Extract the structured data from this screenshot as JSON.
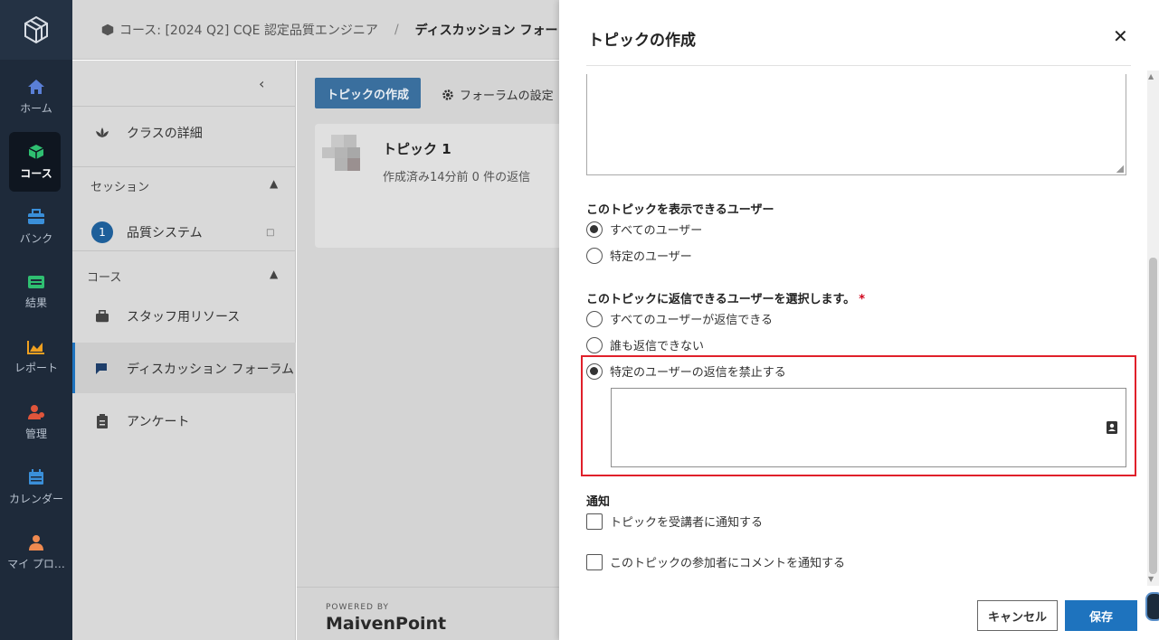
{
  "rail": {
    "items": [
      {
        "label": "ホーム",
        "icon": "home-icon",
        "color": "#5a7fd6"
      },
      {
        "label": "コース",
        "icon": "cube-icon",
        "color": "#2fbf71",
        "active": true
      },
      {
        "label": "バンク",
        "icon": "briefcase-icon",
        "color": "#3a8fd9"
      },
      {
        "label": "結果",
        "icon": "list-icon",
        "color": "#2fbf71"
      },
      {
        "label": "レポート",
        "icon": "chart-icon",
        "color": "#f0a020"
      },
      {
        "label": "管理",
        "icon": "users-gear-icon",
        "color": "#e0553b"
      },
      {
        "label": "カレンダー",
        "icon": "calendar-icon",
        "color": "#3a8fd9"
      },
      {
        "label": "マイ プロ…",
        "icon": "person-icon",
        "color": "#f08a50"
      }
    ]
  },
  "breadcrumb": {
    "course": "コース: [2024 Q2] CQE 認定品質エンジニア",
    "current": "ディスカッション フォーラム"
  },
  "leftnav": {
    "class_details": "クラスの詳細",
    "session_header": "セッション",
    "session_item_number": "1",
    "session_item": "品質システム",
    "course_header": "コース",
    "staff_resources": "スタッフ用リソース",
    "discussion_forum": "ディスカッション フォーラム",
    "survey": "アンケート"
  },
  "main": {
    "create_topic": "トピックの作成",
    "forum_settings": "フォーラムの設定",
    "topic": {
      "title": "トピック 1",
      "meta": "作成済み14分前  0 件の返信"
    },
    "powered_by": "POWERED BY",
    "brand": "MaivenPoint"
  },
  "drawer": {
    "title": "トピックの作成",
    "visibility_label": "このトピックを表示できるユーザー",
    "visibility_options": [
      "すべてのユーザー",
      "特定のユーザー"
    ],
    "visibility_selected": 0,
    "reply_label": "このトピックに返信できるユーザーを選択します。",
    "reply_required_mark": "*",
    "reply_options": [
      "すべてのユーザーが返信できる",
      "誰も返信できない",
      "特定のユーザーの返信を禁止する"
    ],
    "reply_selected": 2,
    "notify_label": "通知",
    "notify_options": [
      "トピックを受講者に通知する",
      "このトピックの参加者にコメントを通知する"
    ],
    "cancel": "キャンセル",
    "save": "保存"
  },
  "colors": {
    "accent": "#1e73be",
    "highlight": "#e0202a",
    "rail_bg": "#1e2a3a"
  }
}
